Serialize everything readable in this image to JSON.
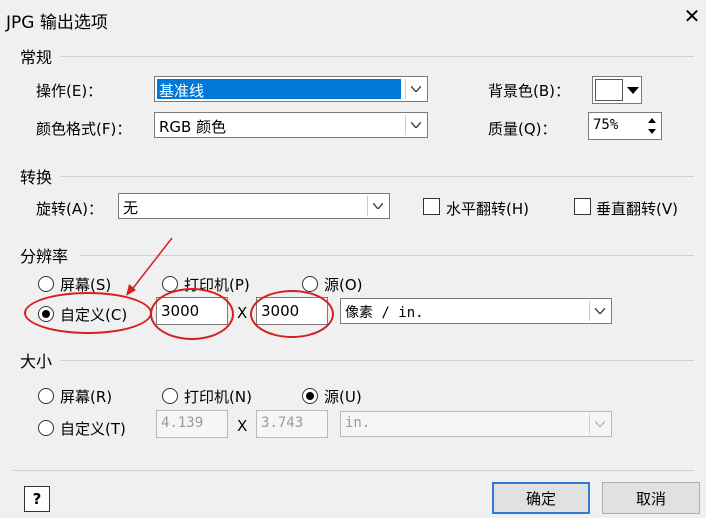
{
  "window": {
    "title": "JPG 输出选项",
    "close": "✕"
  },
  "general": {
    "group_label": "常规",
    "operation_label": "操作(E)：",
    "operation_value": "基准线",
    "color_format_label": "颜色格式(F)：",
    "color_format_value": "RGB 颜色",
    "background_label": "背景色(B)：",
    "quality_label": "质量(Q)：",
    "quality_value": "75%"
  },
  "transform": {
    "group_label": "转换",
    "rotate_label": "旋转(A)：",
    "rotate_value": "无",
    "flip_h_label": "水平翻转(H)",
    "flip_v_label": "垂直翻转(V)"
  },
  "resolution": {
    "group_label": "分辨率",
    "screen_label": "屏幕(S)",
    "printer_label": "打印机(P)",
    "source_label": "源(O)",
    "custom_label": "自定义(C)",
    "width_value": "3000",
    "x_label": "X",
    "height_value": "3000",
    "unit_value": "像素 / in.",
    "selected": "custom"
  },
  "size": {
    "group_label": "大小",
    "screen_label": "屏幕(R)",
    "printer_label": "打印机(N)",
    "source_label": "源(U)",
    "custom_label": "自定义(T)",
    "width_value": "4.139",
    "x_label": "X",
    "height_value": "3.743",
    "unit_value": "in.",
    "selected": "source"
  },
  "footer": {
    "help_label": "?",
    "ok_label": "确定",
    "cancel_label": "取消"
  }
}
